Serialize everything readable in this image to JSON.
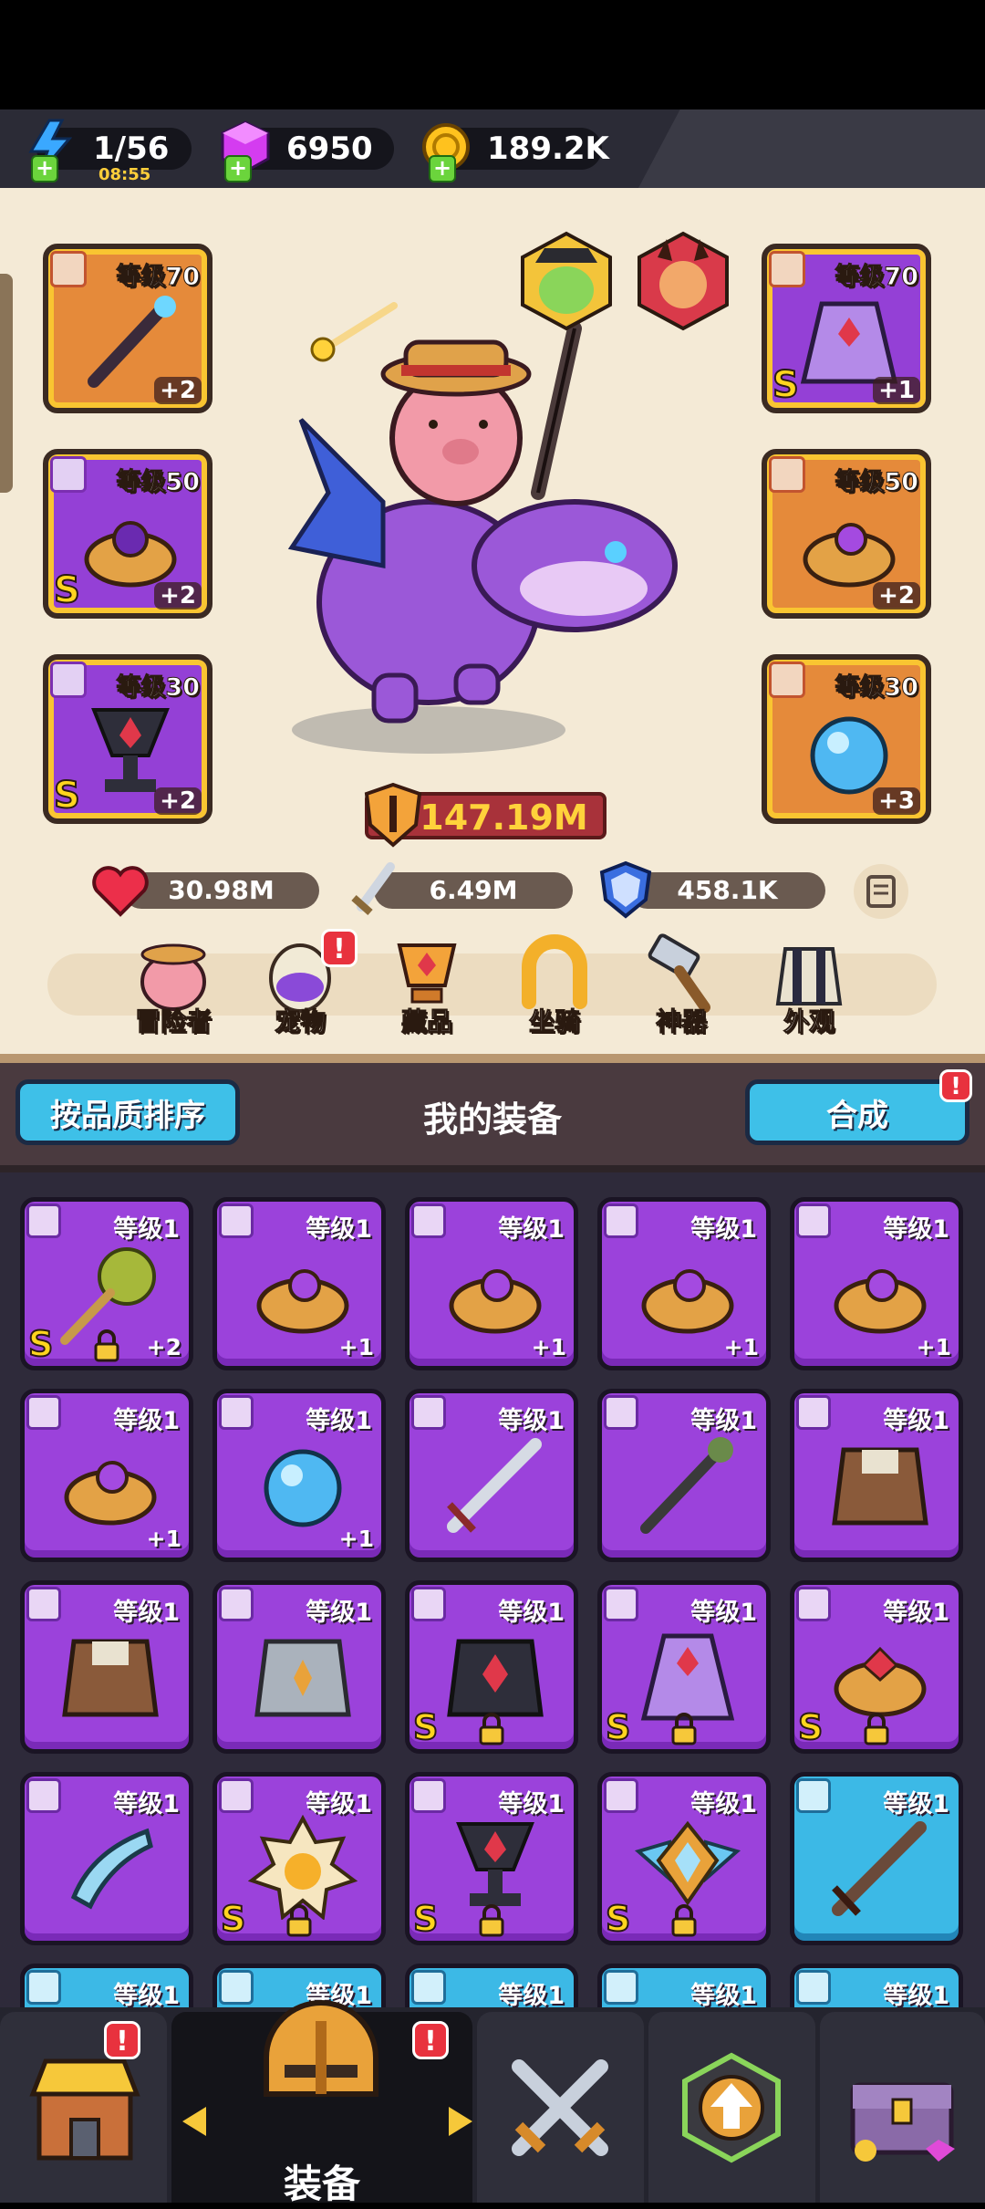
{
  "resources": {
    "energy": {
      "value": "1/56",
      "timer": "08:55",
      "icon": "lightning-icon"
    },
    "gems": {
      "value": "6950",
      "icon": "gem-cube-icon"
    },
    "coins": {
      "value": "189.2K",
      "icon": "coin-icon"
    }
  },
  "hero": {
    "left_slots": [
      {
        "level": "等级70",
        "plus": "+2",
        "s": "",
        "color": "orange",
        "item": "staff"
      },
      {
        "level": "等级50",
        "plus": "+2",
        "s": "S",
        "color": "purple",
        "item": "ring"
      },
      {
        "level": "等级30",
        "plus": "+2",
        "s": "S",
        "color": "purple",
        "item": "trophy"
      }
    ],
    "right_slots": [
      {
        "level": "等级70",
        "plus": "+1",
        "s": "S",
        "color": "purple",
        "item": "cape"
      },
      {
        "level": "等级50",
        "plus": "+2",
        "s": "",
        "color": "orange",
        "item": "ring"
      },
      {
        "level": "等级30",
        "plus": "+3",
        "s": "",
        "color": "orange",
        "item": "orb"
      }
    ],
    "power": "147.19M",
    "stats": {
      "hp": "30.98M",
      "attack": "6.49M",
      "defense": "458.1K"
    }
  },
  "tabs": [
    {
      "label": "冒险者",
      "icon": "adventurer-icon",
      "badge": ""
    },
    {
      "label": "宠物",
      "icon": "pet-egg-icon",
      "badge": "!"
    },
    {
      "label": "藏品",
      "icon": "collection-icon",
      "badge": ""
    },
    {
      "label": "坐骑",
      "icon": "mount-horseshoe-icon",
      "badge": ""
    },
    {
      "label": "神器",
      "icon": "artifact-hammer-icon",
      "badge": ""
    },
    {
      "label": "外观",
      "icon": "outfit-icon",
      "badge": ""
    }
  ],
  "equipment": {
    "sort_button": "按品质排序",
    "title": "我的装备",
    "merge_button": "合成",
    "merge_badge": "!"
  },
  "items": [
    {
      "level": "等级1",
      "plus": "+2",
      "s": "S",
      "lock": true,
      "item": "mace",
      "rarity": "purple"
    },
    {
      "level": "等级1",
      "plus": "+1",
      "s": "",
      "lock": false,
      "item": "ring",
      "rarity": "purple"
    },
    {
      "level": "等级1",
      "plus": "+1",
      "s": "",
      "lock": false,
      "item": "ring",
      "rarity": "purple"
    },
    {
      "level": "等级1",
      "plus": "+1",
      "s": "",
      "lock": false,
      "item": "ring",
      "rarity": "purple"
    },
    {
      "level": "等级1",
      "plus": "+1",
      "s": "",
      "lock": false,
      "item": "ring",
      "rarity": "purple"
    },
    {
      "level": "等级1",
      "plus": "+1",
      "s": "",
      "lock": false,
      "item": "ring",
      "rarity": "purple"
    },
    {
      "level": "等级1",
      "plus": "+1",
      "s": "",
      "lock": false,
      "item": "orb",
      "rarity": "purple"
    },
    {
      "level": "等级1",
      "plus": "",
      "s": "",
      "lock": false,
      "item": "sword",
      "rarity": "purple"
    },
    {
      "level": "等级1",
      "plus": "",
      "s": "",
      "lock": false,
      "item": "staff",
      "rarity": "purple"
    },
    {
      "level": "等级1",
      "plus": "",
      "s": "",
      "lock": false,
      "item": "armor-brown",
      "rarity": "purple"
    },
    {
      "level": "等级1",
      "plus": "",
      "s": "",
      "lock": false,
      "item": "armor-brown",
      "rarity": "purple"
    },
    {
      "level": "等级1",
      "plus": "",
      "s": "",
      "lock": false,
      "item": "armor-steel",
      "rarity": "purple"
    },
    {
      "level": "等级1",
      "plus": "",
      "s": "S",
      "lock": true,
      "item": "armor-dark",
      "rarity": "purple"
    },
    {
      "level": "等级1",
      "plus": "",
      "s": "S",
      "lock": true,
      "item": "cape",
      "rarity": "purple"
    },
    {
      "level": "等级1",
      "plus": "",
      "s": "S",
      "lock": true,
      "item": "ring-red",
      "rarity": "purple"
    },
    {
      "level": "等级1",
      "plus": "",
      "s": "",
      "lock": false,
      "item": "horn",
      "rarity": "purple"
    },
    {
      "level": "等级1",
      "plus": "",
      "s": "S",
      "lock": true,
      "item": "sun-amulet",
      "rarity": "purple"
    },
    {
      "level": "等级1",
      "plus": "",
      "s": "S",
      "lock": true,
      "item": "trophy",
      "rarity": "purple"
    },
    {
      "level": "等级1",
      "plus": "",
      "s": "S",
      "lock": true,
      "item": "wing-badge",
      "rarity": "purple"
    },
    {
      "level": "等级1",
      "plus": "",
      "s": "",
      "lock": false,
      "item": "sword-dark",
      "rarity": "blue"
    },
    {
      "level": "等级1",
      "plus": "",
      "s": "",
      "lock": false,
      "item": "",
      "rarity": "blue"
    },
    {
      "level": "等级1",
      "plus": "",
      "s": "",
      "lock": false,
      "item": "",
      "rarity": "blue"
    },
    {
      "level": "等级1",
      "plus": "",
      "s": "",
      "lock": false,
      "item": "",
      "rarity": "blue"
    },
    {
      "level": "等级1",
      "plus": "",
      "s": "",
      "lock": false,
      "item": "",
      "rarity": "blue"
    },
    {
      "level": "等级1",
      "plus": "",
      "s": "",
      "lock": false,
      "item": "",
      "rarity": "blue"
    }
  ],
  "nav": {
    "active_label": "装备",
    "items": [
      {
        "name": "shop",
        "icon": "shop-icon",
        "badge": "!"
      },
      {
        "name": "equipment",
        "icon": "helmet-icon",
        "badge": "!"
      },
      {
        "name": "battle",
        "icon": "crossed-swords-icon",
        "badge": ""
      },
      {
        "name": "upgrade",
        "icon": "upgrade-arrow-icon",
        "badge": ""
      },
      {
        "name": "treasure",
        "icon": "treasure-chest-icon",
        "badge": ""
      }
    ]
  }
}
